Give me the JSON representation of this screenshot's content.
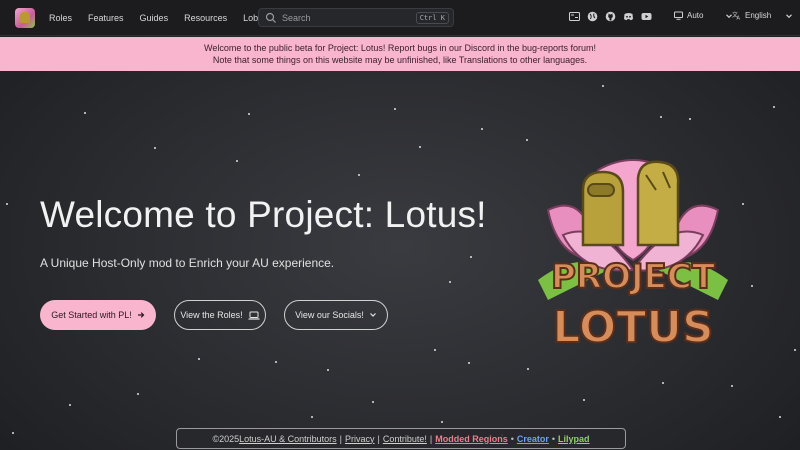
{
  "nav": {
    "links": [
      "Roles",
      "Features",
      "Guides",
      "Resources",
      "Lobbies"
    ],
    "search": {
      "placeholder": "Search",
      "shortcut": "Ctrl K"
    },
    "icons": [
      "translate-icon",
      "globe-icon",
      "github-icon",
      "discord-icon",
      "youtube-icon"
    ],
    "theme_label": "Auto",
    "language_label": "English"
  },
  "banner": {
    "line1": "Welcome to the public beta for Project: Lotus! Report bugs in our Discord in the bug-reports forum!",
    "line2": "Note that some things on this website may be unfinished, like Translations to other languages."
  },
  "hero": {
    "title": "Welcome to Project: Lotus!",
    "subtitle": "A Unique Host-Only mod to Enrich your AU experience.",
    "buttons": {
      "get_started": "Get Started with PL!",
      "roles": "View the Roles!",
      "socials": "View our Socials!"
    },
    "logo_text_top": "PROJECT",
    "logo_text_bottom": "LOTUS"
  },
  "footer": {
    "copyright": "©2025",
    "org": "Lotus-AU & Contributors",
    "privacy": "Privacy",
    "contribute": "Contribute!",
    "modded": "Modded Regions",
    "creator": "Creator",
    "lilypad": "Lilypad"
  },
  "colors": {
    "accent_pink": "#f8b5cd",
    "nav_bg": "#1c1c1f",
    "modded": "#f07d8c",
    "creator": "#6ea2f2",
    "lilypad": "#8fd16b"
  }
}
